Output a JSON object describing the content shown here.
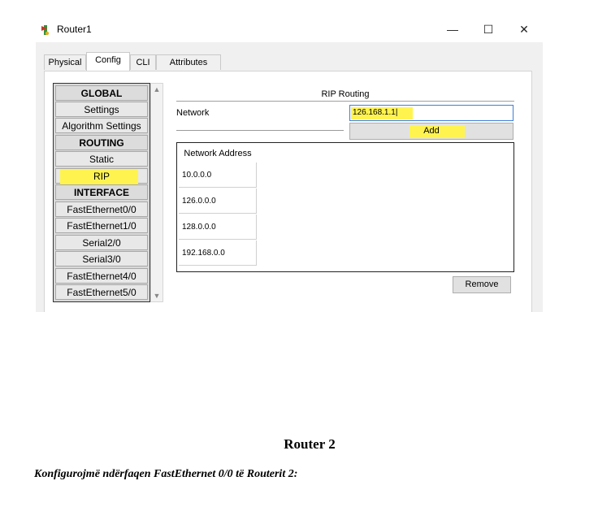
{
  "window": {
    "title": "Router1",
    "minimize": "—",
    "maximize": "☐",
    "close": "✕"
  },
  "tabs": [
    {
      "label": "Physical"
    },
    {
      "label": "Config",
      "active": true
    },
    {
      "label": "CLI"
    },
    {
      "label": "Attributes"
    }
  ],
  "sidebar": {
    "items": [
      {
        "label": "GLOBAL",
        "type": "header"
      },
      {
        "label": "Settings"
      },
      {
        "label": "Algorithm Settings"
      },
      {
        "label": "ROUTING",
        "type": "header"
      },
      {
        "label": "Static"
      },
      {
        "label": "RIP",
        "selected": true,
        "highlighted": true
      },
      {
        "label": "INTERFACE",
        "type": "header"
      },
      {
        "label": "FastEthernet0/0"
      },
      {
        "label": "FastEthernet1/0"
      },
      {
        "label": "Serial2/0"
      },
      {
        "label": "Serial3/0"
      },
      {
        "label": "FastEthernet4/0"
      },
      {
        "label": "FastEthernet5/0"
      }
    ]
  },
  "rip": {
    "section_title": "RIP Routing",
    "network_label": "Network",
    "network_value": "126.168.1.1",
    "add_label": "Add",
    "table_header": "Network Address",
    "networks": [
      "10.0.0.0",
      "126.0.0.0",
      "128.0.0.0",
      "192.168.0.0"
    ],
    "remove_label": "Remove"
  },
  "document": {
    "heading": "Router 2",
    "text": "Konfigurojmë ndërfaqen FastEthernet 0/0 të Routerit 2:"
  },
  "colors": {
    "highlight": "#fff44f",
    "input_focus_border": "#3c7fd6"
  }
}
